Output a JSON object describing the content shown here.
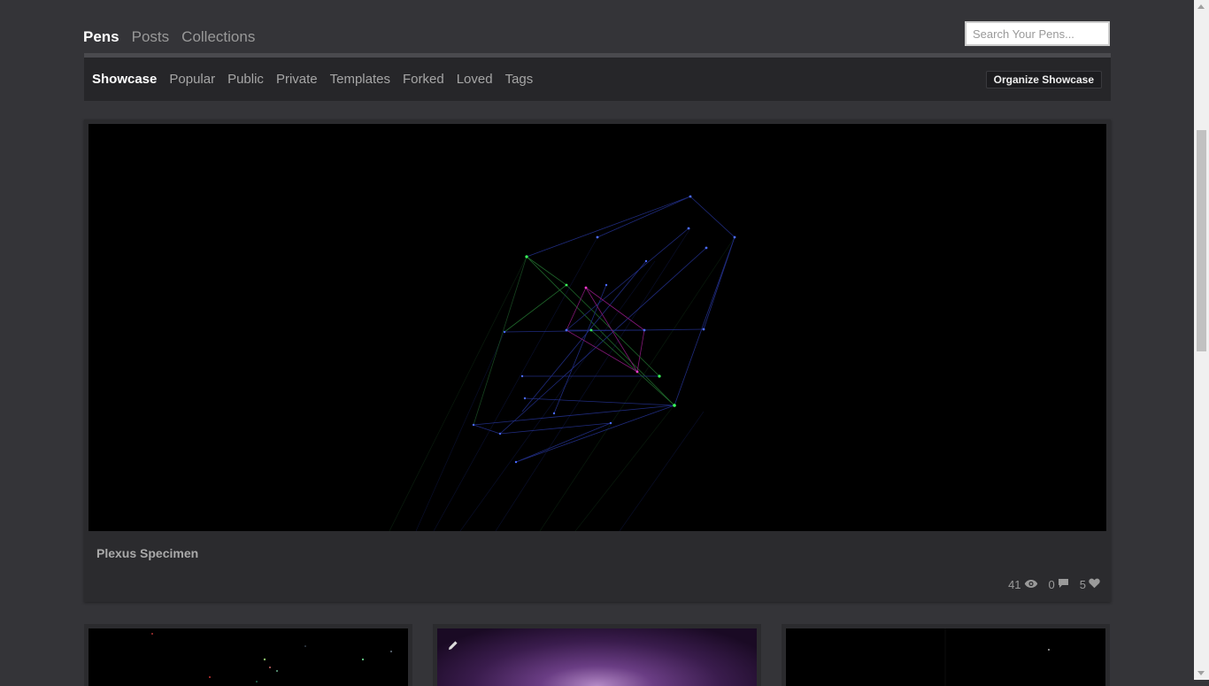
{
  "top_tabs": [
    "Pens",
    "Posts",
    "Collections"
  ],
  "search": {
    "placeholder": "Search Your Pens..."
  },
  "subnav": {
    "items": [
      "Showcase",
      "Popular",
      "Public",
      "Private",
      "Templates",
      "Forked",
      "Loved",
      "Tags"
    ],
    "organize_label": "Organize Showcase"
  },
  "showcase": {
    "title": "Plexus Specimen",
    "views": "41",
    "comments": "0",
    "loves": "5"
  },
  "icons": {
    "views": "eye-icon",
    "comments": "comment-icon",
    "loves": "heart-icon",
    "edit": "pencil-icon"
  },
  "colors": {
    "background": "#343438",
    "subnav_bg": "#262629",
    "active_text": "#ffffff"
  }
}
